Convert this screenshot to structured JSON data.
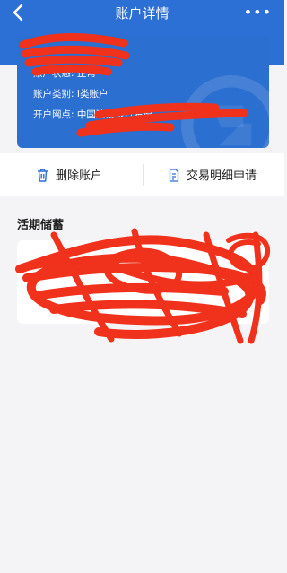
{
  "nav": {
    "title": "账户详情",
    "more": "•••"
  },
  "account": {
    "status_label": "账户状态:",
    "status_value": "正常",
    "type_label": "账户类别:",
    "type_value": "I类账户",
    "branch_label": "开户网点:",
    "branch_value": "中国建设银行股份"
  },
  "actions": {
    "delete": "删除账户",
    "statement": "交易明细申请"
  },
  "section": {
    "title": "活期储蓄"
  },
  "colors": {
    "brand": "#2c6fd5",
    "redaction": "#f0321c"
  }
}
